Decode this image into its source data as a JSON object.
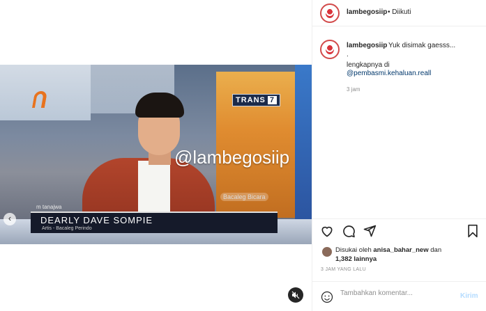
{
  "header": {
    "username": "lambegosiip",
    "separator": "•",
    "follow_status": "Diikuti"
  },
  "caption": {
    "username": "lambegosiip",
    "text": "Yuk disimak gaesss...",
    "line_dot": ".",
    "line2": "lengkapnya di",
    "mention": "@pembasmi.kehaluan.reall",
    "time": "3 jam"
  },
  "video": {
    "channel": "TRANS",
    "channel_num": "7",
    "watermark": "@lambegosiip",
    "show_small": "m tanajwa",
    "show_tag": "Bacaleg Bicara",
    "name": "DEARLY DAVE SOMPIE",
    "role": "Artis - Bacaleg Perindo",
    "prev_arrow": "‹"
  },
  "likes": {
    "prefix": "Disukai oleh",
    "user": "anisa_bahar_new",
    "and": "dan",
    "count": "1,382 lainnya"
  },
  "posted_ago": "3 JAM YANG LALU",
  "comment": {
    "placeholder": "Tambahkan komentar...",
    "send_label": "Kirim"
  },
  "icons": [
    "heart-icon",
    "comment-icon",
    "share-icon",
    "bookmark-icon",
    "emoji-icon",
    "mute-icon",
    "chevron-left-icon"
  ]
}
